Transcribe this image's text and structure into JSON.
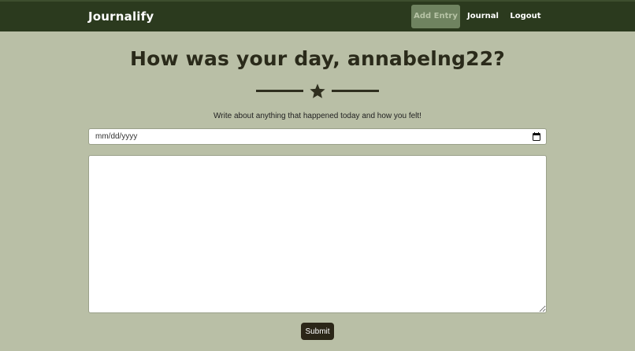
{
  "navbar": {
    "brand": "Journalify",
    "links": [
      {
        "label": "Add Entry",
        "active": true
      },
      {
        "label": "Journal",
        "active": false
      },
      {
        "label": "Logout",
        "active": false
      }
    ]
  },
  "main": {
    "heading": "How was your day, annabelng22?",
    "divider_icon": "star-icon",
    "subtitle": "Write about anything that happened today and how you felt!",
    "date_field": {
      "placeholder": "mm/dd/yyyy",
      "value": "",
      "icon": "calendar-icon"
    },
    "entry_textarea": {
      "value": "",
      "placeholder": ""
    },
    "submit_label": "Submit"
  },
  "colors": {
    "navbar_bg": "#2b3a1e",
    "active_link_bg": "#6f8360",
    "page_bg": "#b9bfa6",
    "text_dark": "#2a2a1a",
    "button_bg": "#2b2618"
  }
}
